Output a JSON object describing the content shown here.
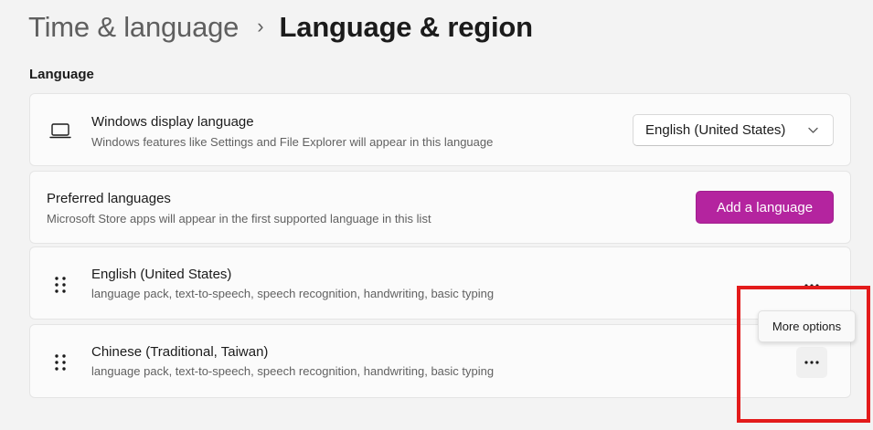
{
  "breadcrumb": {
    "parent": "Time & language",
    "separator": "›",
    "current": "Language & region"
  },
  "language_section": {
    "label": "Language",
    "display_language": {
      "icon": "laptop-icon",
      "title": "Windows display language",
      "subtitle": "Windows features like Settings and File Explorer will appear in this language",
      "selected_value": "English (United States)",
      "dropdown_icon": "chevron-down-icon"
    },
    "preferred_languages": {
      "title": "Preferred languages",
      "subtitle": "Microsoft Store apps will appear in the first supported language in this list",
      "add_button_label": "Add a language"
    },
    "languages": [
      {
        "name": "English (United States)",
        "features": "language pack, text-to-speech, speech recognition, handwriting, basic typing"
      },
      {
        "name": "Chinese (Traditional, Taiwan)",
        "features": "language pack, text-to-speech, speech recognition, handwriting, basic typing"
      }
    ]
  },
  "tooltip": {
    "text": "More options"
  },
  "colors": {
    "accent": "#b4249f",
    "highlight": "#e31b1b",
    "background": "#f3f3f3",
    "card": "#fbfbfb"
  }
}
